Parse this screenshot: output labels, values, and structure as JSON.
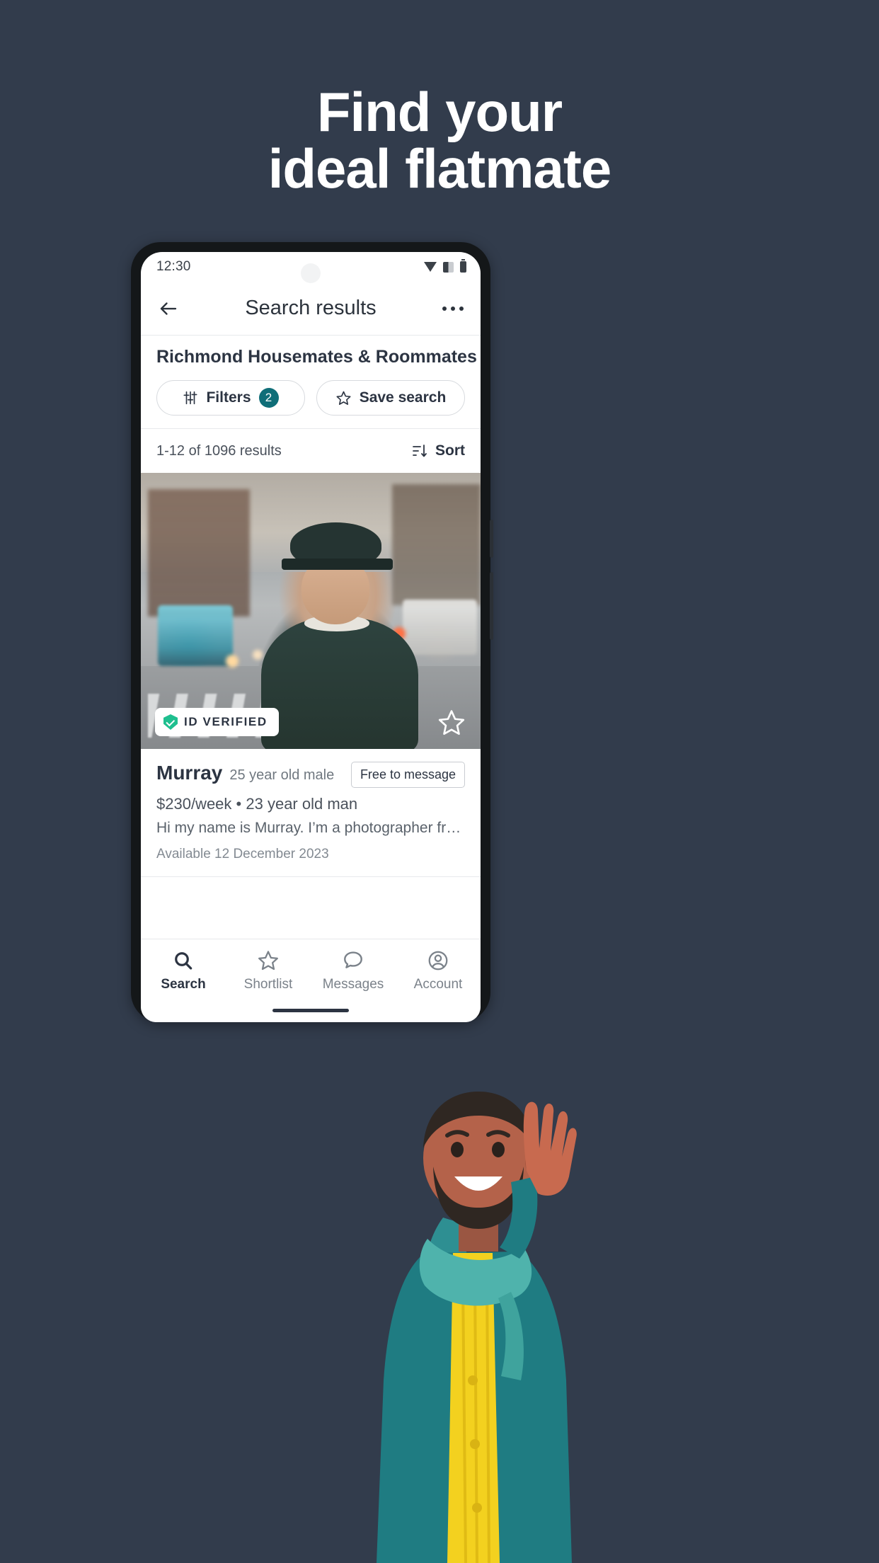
{
  "promo": {
    "headline_line1": "Find your",
    "headline_line2": "ideal flatmate",
    "background_color": "#323c4c"
  },
  "statusbar": {
    "time": "12:30",
    "icons": [
      "wifi-icon",
      "signal-icon",
      "battery-icon"
    ]
  },
  "appbar": {
    "back_label": "←",
    "title": "Search results",
    "more_label": "⋯"
  },
  "search_header": {
    "title": "Richmond Housemates & Roommates",
    "filters_label": "Filters",
    "filters_count": "2",
    "save_search_label": "Save search",
    "badge_color": "#0f6e78"
  },
  "results_bar": {
    "count_text": "1-12 of 1096 results",
    "sort_label": "Sort"
  },
  "listing": {
    "verified_label": "ID VERIFIED",
    "verified_color": "#1fbf8f",
    "name": "Murray",
    "subtitle": "25 year old male",
    "free_to_message_label": "Free to message",
    "price": "$230/week",
    "separator": "•",
    "detail": "23 year old man",
    "description": "Hi my name is Murray. I’m a photographer from N…",
    "availability": "Available 12 December 2023"
  },
  "bottom_nav": {
    "items": [
      {
        "label": "Search",
        "icon": "search-icon",
        "active": true
      },
      {
        "label": "Shortlist",
        "icon": "star-icon",
        "active": false
      },
      {
        "label": "Messages",
        "icon": "chat-icon",
        "active": false
      },
      {
        "label": "Account",
        "icon": "account-icon",
        "active": false
      }
    ]
  }
}
